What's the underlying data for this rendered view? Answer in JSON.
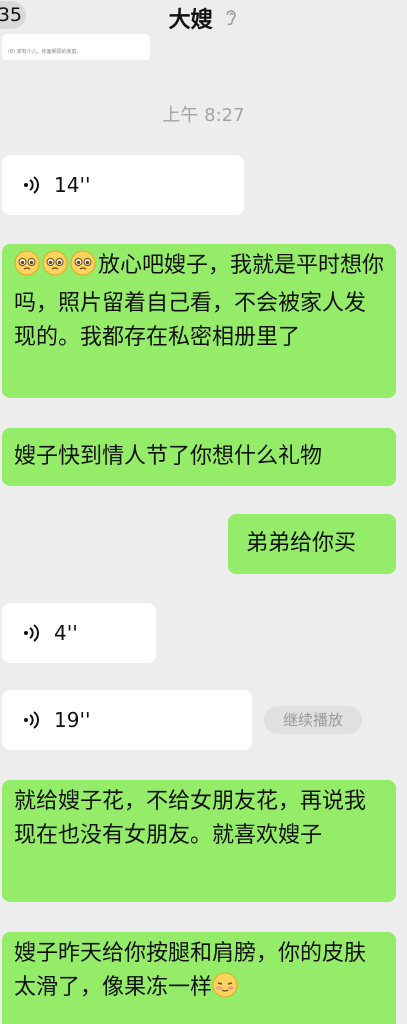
{
  "header": {
    "unread_count": "35",
    "title": "大嫂",
    "mute_icon": "ear-icon"
  },
  "card_snippet": "(8) 家有小儿，体面朝阳的家庭。",
  "time_separator": "上午 8:27",
  "messages": [
    {
      "side": "left",
      "type": "voice",
      "duration": "14''"
    },
    {
      "side": "right",
      "type": "text",
      "emoji": "pleading-face x3",
      "text": "放心吧嫂子，我就是平时想你吗，照片留着自己看，不会被家人发现的。我都存在私密相册里了"
    },
    {
      "side": "right",
      "type": "text",
      "text": "嫂子快到情人节了你想什么礼物"
    },
    {
      "side": "right",
      "type": "text",
      "text": "弟弟给你买"
    },
    {
      "side": "left",
      "type": "voice",
      "duration": "4''"
    },
    {
      "side": "left",
      "type": "voice",
      "duration": "19''",
      "action_label": "继续播放"
    },
    {
      "side": "right",
      "type": "text",
      "text": "就给嫂子花，不给女朋友花，再说我现在也没有女朋友。就喜欢嫂子"
    },
    {
      "side": "right",
      "type": "text",
      "text": "嫂子昨天给你按腿和肩膀，你的皮肤太滑了，像果冻一样",
      "emoji": "shy-face"
    }
  ],
  "colors": {
    "background": "#ededed",
    "right_bubble": "#95ec69",
    "left_bubble": "#ffffff"
  }
}
